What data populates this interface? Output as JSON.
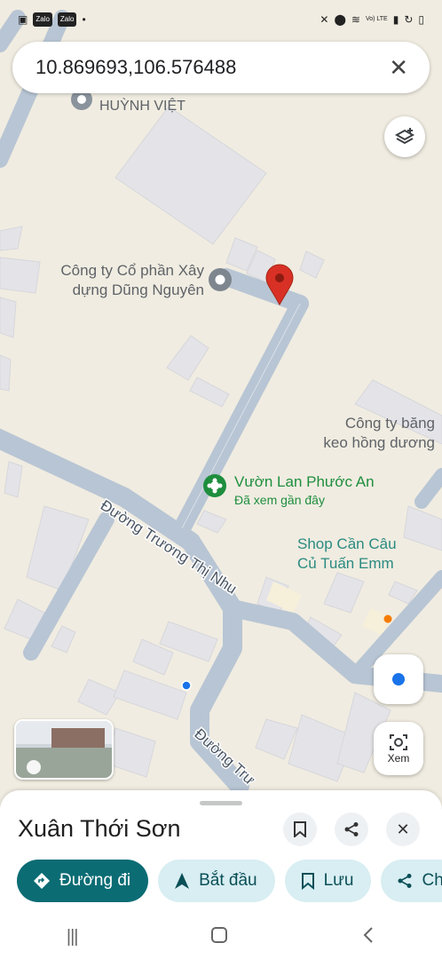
{
  "status_bar": {
    "notification_icons": [
      "gallery-icon",
      "Zalo",
      "Zalo"
    ],
    "network": "Vo) LTE"
  },
  "search": {
    "value": "10.869693,106.576488"
  },
  "map": {
    "labels": {
      "huynh_viet": "HUỲNH VIỆT",
      "cong_ty_xay_dung": [
        "Công ty Cổ phần Xây",
        "dựng Dũng Nguyên"
      ],
      "cong_ty_bang_keo": [
        "Công ty băng",
        "keo hồng dương"
      ],
      "vuon_lan": "Vườn Lan Phước An",
      "vuon_lan_sub": "Đã xem gần đây",
      "shop": [
        "Shop Cần Câu",
        "Củ Tuấn Emm"
      ],
      "road_truong_thi_nhu": "Đường Trương Thị Nhu",
      "road_truong_2": "Đường Trư"
    }
  },
  "buttons": {
    "xem_label": "Xem"
  },
  "sheet": {
    "title": "Xuân Thới Sơn",
    "chips": [
      {
        "label": "Đường đi",
        "icon": "directions-icon"
      },
      {
        "label": "Bắt đầu",
        "icon": "navigation-icon"
      },
      {
        "label": "Lưu",
        "icon": "bookmark-icon"
      },
      {
        "label": "Ch",
        "icon": "share-icon"
      }
    ]
  },
  "colors": {
    "accent": "#0b6c74",
    "pin": "#d93025",
    "map_bg": "#f0ece1",
    "road": "#b7c4d3",
    "building": "#e3e3e6"
  }
}
